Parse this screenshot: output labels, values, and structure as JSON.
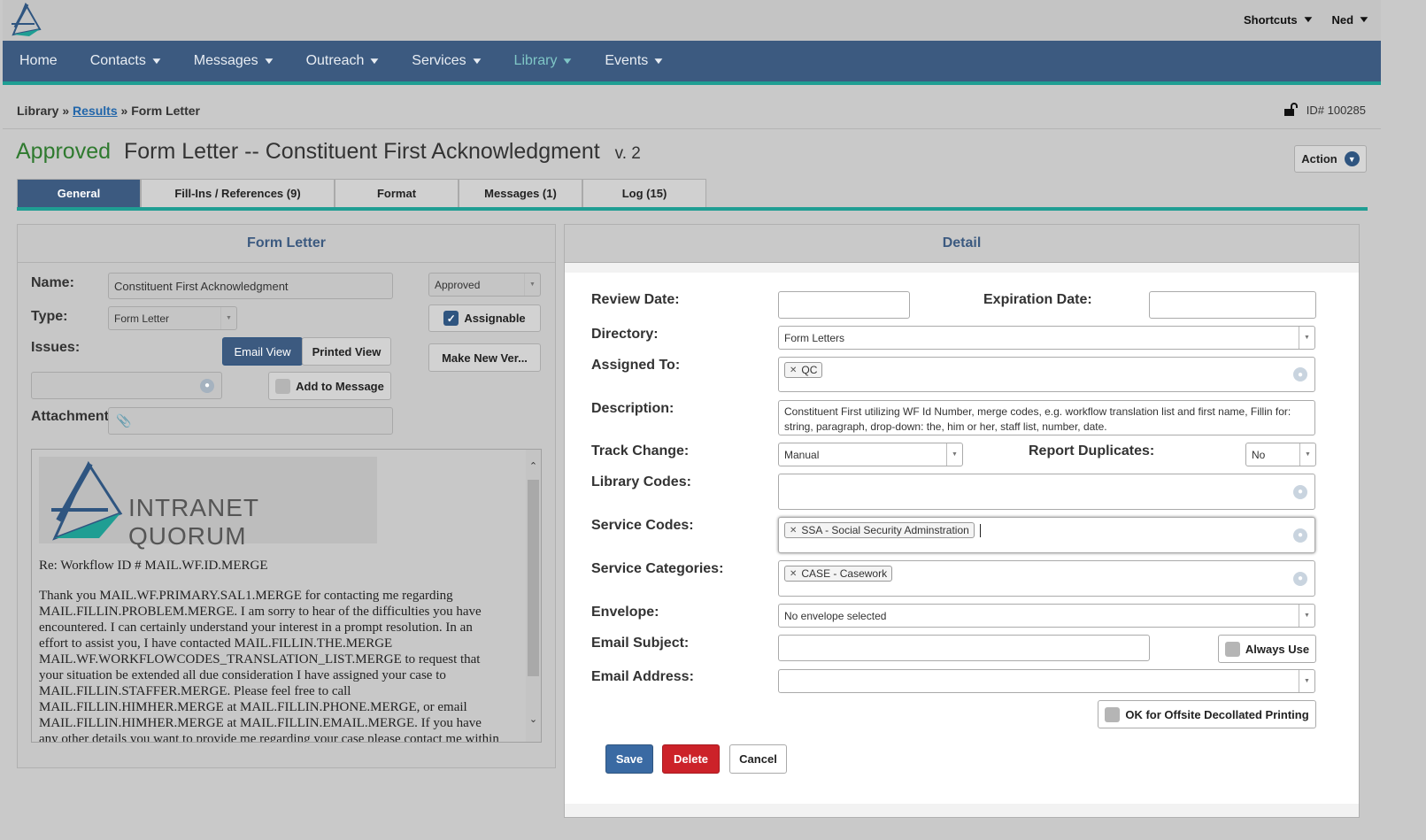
{
  "topbar": {
    "shortcuts": "Shortcuts",
    "user": "Ned"
  },
  "nav": [
    {
      "label": "Home",
      "dropdown": false,
      "active": false
    },
    {
      "label": "Contacts",
      "dropdown": true,
      "active": false
    },
    {
      "label": "Messages",
      "dropdown": true,
      "active": false
    },
    {
      "label": "Outreach",
      "dropdown": true,
      "active": false
    },
    {
      "label": "Services",
      "dropdown": true,
      "active": false
    },
    {
      "label": "Library",
      "dropdown": true,
      "active": true
    },
    {
      "label": "Events",
      "dropdown": true,
      "active": false
    }
  ],
  "breadcrumb": {
    "root": "Library",
    "sep": "»",
    "link": "Results",
    "current": "Form Letter"
  },
  "record_id": "ID# 100285",
  "title": {
    "status": "Approved",
    "type": "Form Letter --",
    "name": "Constituent First Acknowledgment",
    "version": "v. 2"
  },
  "action_label": "Action",
  "tabs": [
    "General",
    "Fill-Ins / References (9)",
    "Format",
    "Messages (1)",
    "Log (15)"
  ],
  "left": {
    "header": "Form Letter",
    "name_label": "Name:",
    "name_value": "Constituent First Acknowledgment",
    "status_value": "Approved",
    "type_label": "Type:",
    "type_value": "Form Letter",
    "assignable_label": "Assignable",
    "issues_label": "Issues:",
    "email_view": "Email View",
    "printed_view": "Printed View",
    "make_new_version": "Make New Ver...",
    "add_to_message": "Add to Message",
    "attachments_label": "Attachments:",
    "brand": "INTRANET QUORUM",
    "letter_re": "Re:  Workflow ID # MAIL.WF.ID.MERGE",
    "letter_lines": [
      "Thank you MAIL.WF.PRIMARY.SAL1.MERGE for contacting me regarding",
      "MAIL.FILLIN.PROBLEM.MERGE. I am sorry to hear of the difficulties you have",
      "encountered.  I can certainly understand your interest in a prompt resolution.  In an",
      "effort to assist you, I have contacted MAIL.FILLIN.THE.MERGE",
      "MAIL.WF.WORKFLOWCODES_TRANSLATION_LIST.MERGE to request that",
      "your situation be extended all due consideration I have assigned your case to",
      "MAIL.FILLIN.STAFFER.MERGE.  Please feel free to call",
      "MAIL.FILLIN.HIMHER.MERGE at MAIL.FILLIN.PHONE.MERGE, or email",
      "MAIL.FILLIN.HIMHER.MERGE at MAIL.FILLIN.EMAIL.MERGE.  If you have",
      "any other details you want to provide me regarding your case please contact me within"
    ]
  },
  "right": {
    "header": "Detail",
    "review_date_label": "Review Date:",
    "expiration_date_label": "Expiration Date:",
    "directory_label": "Directory:",
    "directory_value": "Form Letters",
    "assigned_to_label": "Assigned To:",
    "assigned_tag": "QC",
    "description_label": "Description:",
    "description_value": "Constituent First utilizing WF Id Number, merge codes, e.g. workflow translation list and first name, Fillin for: string, paragraph, drop-down:  the, him or her, staff list, number, date.",
    "track_change_label": "Track Change:",
    "track_change_value": "Manual",
    "report_duplicates_label": "Report Duplicates:",
    "report_duplicates_value": "No",
    "library_codes_label": "Library Codes:",
    "service_codes_label": "Service Codes:",
    "service_code_tag": "SSA - Social Security Adminstration",
    "service_categories_label": "Service Categories:",
    "service_category_tag": "CASE - Casework",
    "envelope_label": "Envelope:",
    "envelope_value": "No envelope selected",
    "email_subject_label": "Email Subject:",
    "always_use_label": "Always Use",
    "email_address_label": "Email Address:",
    "offsite_label": "OK for Offsite Decollated Printing",
    "save": "Save",
    "delete": "Delete",
    "cancel": "Cancel"
  },
  "colors": {
    "nav_bg": "#3c5a80",
    "accent": "#1f9e93",
    "approved": "#2f7a2f",
    "save": "#3a6aa3",
    "delete": "#cc2229"
  }
}
